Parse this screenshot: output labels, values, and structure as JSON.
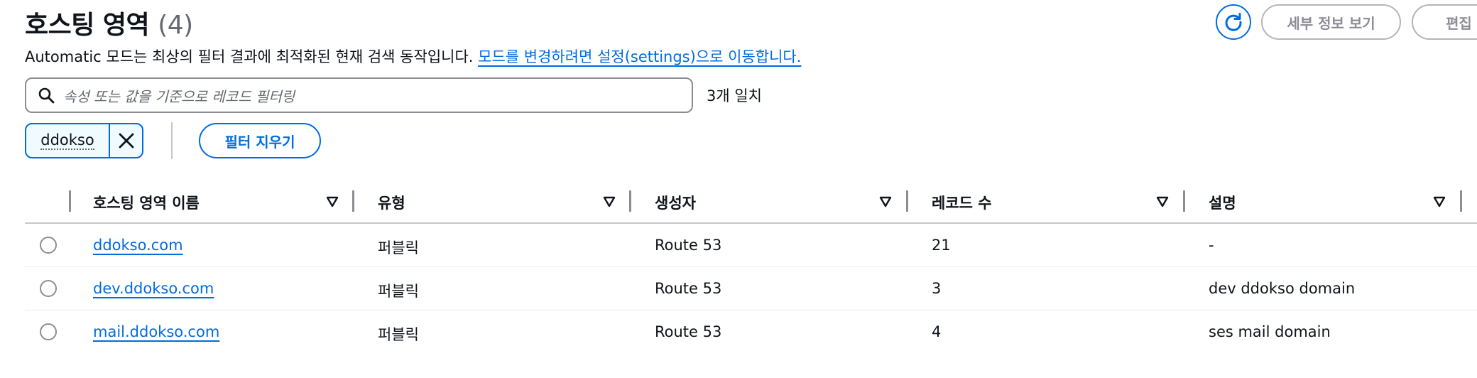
{
  "header": {
    "title": "호스팅 영역",
    "count": "(4)",
    "details_button": "세부 정보 보기",
    "edit_button": "편집"
  },
  "info": {
    "text": "Automatic 모드는 최상의 필터 결과에 최적화된 현재 검색 동작입니다.",
    "link": "모드를 변경하려면 설정(settings)으로 이동합니다."
  },
  "filter": {
    "placeholder": "속성 또는 값을 기준으로 레코드 필터링",
    "match_count": "3개 일치",
    "token": "ddokso",
    "clear_button": "필터 지우기"
  },
  "table": {
    "columns": [
      "호스팅 영역 이름",
      "유형",
      "생성자",
      "레코드 수",
      "설명"
    ],
    "rows": [
      [
        "ddokso.com",
        "퍼블릭",
        "Route 53",
        "21",
        "-"
      ],
      [
        "dev.ddokso.com",
        "퍼블릭",
        "Route 53",
        "3",
        "dev ddokso domain"
      ],
      [
        "mail.ddokso.com",
        "퍼블릭",
        "Route 53",
        "4",
        "ses mail domain"
      ]
    ]
  },
  "colors": {
    "accent": "#006ce0",
    "text": "#0f141a",
    "muted": "#656871",
    "border": "#8c8c94",
    "disabled": "#b4b4bb"
  },
  "icons": {
    "refresh": "refresh-icon",
    "search": "search-icon",
    "dismiss": "close-icon",
    "sort": "sort-caret-icon",
    "radio": "radio-button"
  }
}
